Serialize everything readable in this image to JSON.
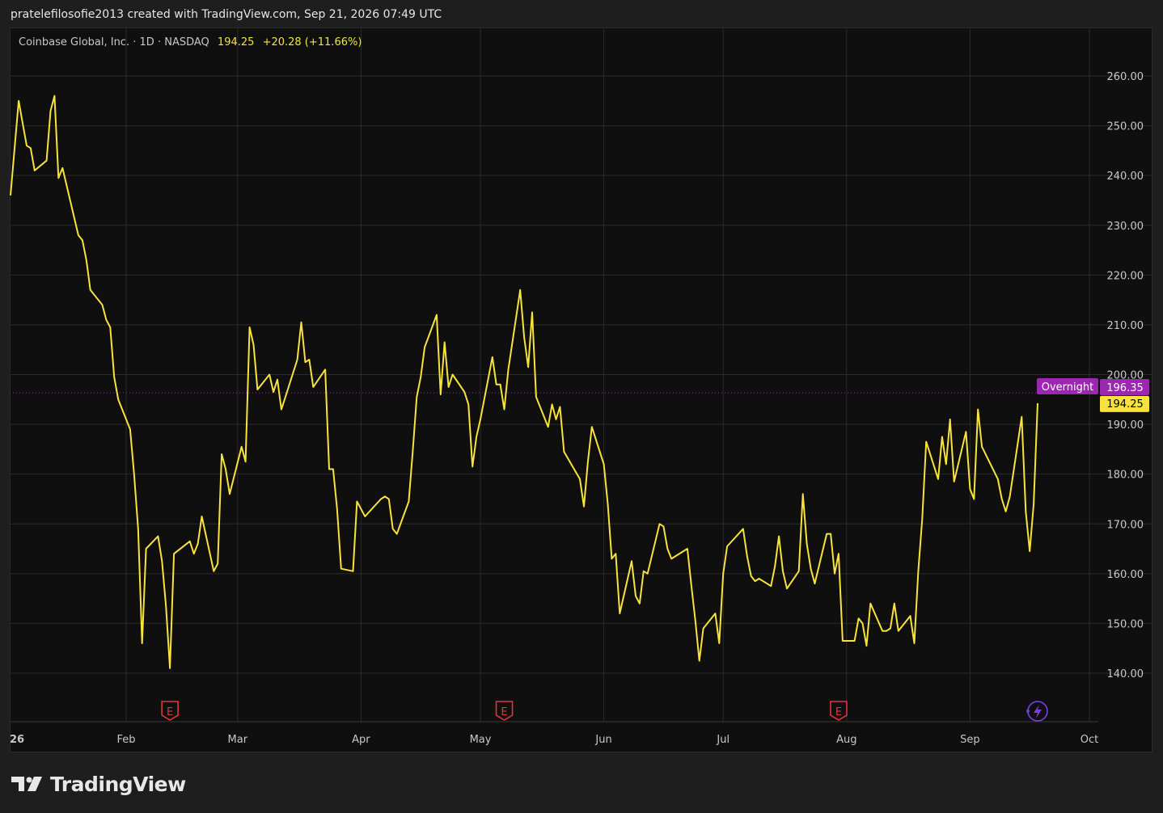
{
  "header": {
    "attribution": "pratelefilosofie2013 created with TradingView.com, Sep 21, 2026 07:49 UTC"
  },
  "symbol": {
    "name": "Coinbase Global, Inc.",
    "interval": "1D",
    "exchange": "NASDAQ",
    "price": "194.25",
    "change": "+20.28 (+11.66%)",
    "separator": "·"
  },
  "labels": {
    "overnight": "Overnight",
    "overnight_price": "196.35",
    "last_price": "194.25",
    "earnings_marker": "E"
  },
  "footer": {
    "brand": "TradingView"
  },
  "colors": {
    "line": "#f7e33b",
    "background": "#0f0f0f",
    "grid": "#2b2b2b",
    "overnight": "#9c27b0",
    "last_price_bg": "#f7e33b",
    "earnings": "#e0353f",
    "axis_text": "#c8c8c8"
  },
  "chart_data": {
    "type": "line",
    "title": "Coinbase Global, Inc. · 1D · NASDAQ",
    "ylim": [
      130,
      265
    ],
    "y_ticks": [
      "260.00",
      "250.00",
      "240.00",
      "230.00",
      "220.00",
      "210.00",
      "200.00",
      "190.00",
      "180.00",
      "170.00",
      "160.00",
      "150.00",
      "140.00"
    ],
    "x_ticks": [
      "26",
      "Feb",
      "Mar",
      "Apr",
      "May",
      "Jun",
      "Jul",
      "Aug",
      "Sep",
      "Oct"
    ],
    "grid": true,
    "overnight_price": 196.35,
    "last_price": 194.25,
    "earnings_dates": [
      "2026-02-12",
      "2026-05-07",
      "2026-07-30"
    ],
    "series": [
      {
        "x": [
          "2026-01-02",
          "2026-01-05",
          "2026-01-06",
          "2026-01-07",
          "2026-01-08",
          "2026-01-09",
          "2026-01-12",
          "2026-01-13",
          "2026-01-14",
          "2026-01-15",
          "2026-01-16",
          "2026-01-20",
          "2026-01-21",
          "2026-01-22",
          "2026-01-23",
          "2026-01-26",
          "2026-01-27",
          "2026-01-28",
          "2026-01-29",
          "2026-01-30",
          "2026-02-02",
          "2026-02-03",
          "2026-02-04",
          "2026-02-05",
          "2026-02-06",
          "2026-02-09",
          "2026-02-10",
          "2026-02-11",
          "2026-02-12",
          "2026-02-13",
          "2026-02-17",
          "2026-02-18",
          "2026-02-19",
          "2026-02-20",
          "2026-02-23",
          "2026-02-24",
          "2026-02-25",
          "2026-02-26",
          "2026-02-27",
          "2026-03-02",
          "2026-03-03",
          "2026-03-04",
          "2026-03-05",
          "2026-03-06",
          "2026-03-09",
          "2026-03-10",
          "2026-03-11",
          "2026-03-12",
          "2026-03-13",
          "2026-03-16",
          "2026-03-17",
          "2026-03-18",
          "2026-03-19",
          "2026-03-20",
          "2026-03-23",
          "2026-03-24",
          "2026-03-25",
          "2026-03-26",
          "2026-03-27",
          "2026-03-30",
          "2026-03-31",
          "2026-04-01",
          "2026-04-02",
          "2026-04-06",
          "2026-04-07",
          "2026-04-08",
          "2026-04-09",
          "2026-04-10",
          "2026-04-13",
          "2026-04-14",
          "2026-04-15",
          "2026-04-16",
          "2026-04-17",
          "2026-04-20",
          "2026-04-21",
          "2026-04-22",
          "2026-04-23",
          "2026-04-24",
          "2026-04-27",
          "2026-04-28",
          "2026-04-29",
          "2026-04-30",
          "2026-05-01",
          "2026-05-04",
          "2026-05-05",
          "2026-05-06",
          "2026-05-07",
          "2026-05-08",
          "2026-05-11",
          "2026-05-12",
          "2026-05-13",
          "2026-05-14",
          "2026-05-15",
          "2026-05-18",
          "2026-05-19",
          "2026-05-20",
          "2026-05-21",
          "2026-05-22",
          "2026-05-26",
          "2026-05-27",
          "2026-05-28",
          "2026-05-29",
          "2026-06-01",
          "2026-06-02",
          "2026-06-03",
          "2026-06-04",
          "2026-06-05",
          "2026-06-08",
          "2026-06-09",
          "2026-06-10",
          "2026-06-11",
          "2026-06-12",
          "2026-06-15",
          "2026-06-16",
          "2026-06-17",
          "2026-06-18",
          "2026-06-22",
          "2026-06-23",
          "2026-06-24",
          "2026-06-25",
          "2026-06-26",
          "2026-06-29",
          "2026-06-30",
          "2026-07-01",
          "2026-07-02",
          "2026-07-06",
          "2026-07-07",
          "2026-07-08",
          "2026-07-09",
          "2026-07-10",
          "2026-07-13",
          "2026-07-14",
          "2026-07-15",
          "2026-07-16",
          "2026-07-17",
          "2026-07-20",
          "2026-07-21",
          "2026-07-22",
          "2026-07-23",
          "2026-07-24",
          "2026-07-27",
          "2026-07-28",
          "2026-07-29",
          "2026-07-30",
          "2026-07-31",
          "2026-08-03",
          "2026-08-04",
          "2026-08-05",
          "2026-08-06",
          "2026-08-07",
          "2026-08-10",
          "2026-08-11",
          "2026-08-12",
          "2026-08-13",
          "2026-08-14",
          "2026-08-17",
          "2026-08-18",
          "2026-08-19",
          "2026-08-20",
          "2026-08-21",
          "2026-08-24",
          "2026-08-25",
          "2026-08-26",
          "2026-08-27",
          "2026-08-28",
          "2026-08-31",
          "2026-09-01",
          "2026-09-02",
          "2026-09-03",
          "2026-09-04",
          "2026-09-08",
          "2026-09-09",
          "2026-09-10",
          "2026-09-11",
          "2026-09-14",
          "2026-09-15",
          "2026-09-16",
          "2026-09-17",
          "2026-09-18"
        ],
        "values": [
          236.0,
          255.0,
          250.5,
          246.0,
          245.5,
          241.0,
          243.0,
          253.0,
          256.0,
          239.5,
          241.5,
          228.0,
          227.0,
          223.0,
          217.0,
          214.0,
          211.0,
          209.5,
          199.5,
          195.0,
          189.0,
          180.0,
          169.0,
          146.0,
          165.0,
          167.5,
          162.5,
          153.5,
          141.0,
          164.0,
          166.5,
          164.0,
          166.0,
          171.5,
          160.5,
          162.0,
          184.0,
          181.0,
          176.0,
          185.5,
          182.5,
          209.5,
          206.0,
          197.0,
          200.0,
          196.5,
          199.0,
          193.0,
          195.5,
          203.0,
          210.5,
          202.5,
          203.0,
          197.5,
          201.0,
          181.0,
          181.0,
          173.0,
          161.0,
          160.5,
          174.5,
          173.0,
          171.5,
          175.0,
          175.5,
          175.0,
          169.0,
          168.0,
          174.5,
          184.5,
          195.5,
          199.5,
          205.5,
          212.0,
          196.0,
          206.5,
          197.5,
          200.0,
          196.5,
          194.0,
          181.5,
          187.5,
          191.0,
          203.5,
          198.0,
          198.0,
          193.0,
          201.0,
          217.0,
          207.5,
          201.5,
          212.5,
          195.5,
          189.5,
          194.0,
          191.0,
          193.5,
          184.5,
          179.0,
          173.5,
          182.5,
          189.5,
          182.0,
          174.0,
          163.0,
          164.0,
          152.0,
          162.5,
          155.5,
          154.0,
          160.5,
          160.0,
          170.0,
          169.5,
          165.0,
          163.0,
          165.0,
          157.5,
          150.5,
          142.5,
          149.0,
          152.0,
          146.0,
          160.0,
          165.5,
          169.0,
          163.5,
          159.5,
          158.5,
          159.0,
          157.5,
          161.5,
          167.5,
          160.5,
          157.0,
          160.5,
          176.0,
          166.0,
          161.0,
          158.0,
          168.0,
          168.0,
          160.0,
          164.0,
          146.5,
          146.5,
          151.0,
          150.0,
          145.5,
          154.0,
          148.5,
          148.5,
          149.0,
          154.0,
          148.5,
          151.5,
          146.0,
          160.5,
          171.0,
          186.5,
          179.0,
          187.5,
          182.0,
          191.0,
          178.5,
          188.5,
          177.0,
          175.0,
          193.0,
          185.5,
          179.0,
          175.0,
          172.5,
          175.5,
          191.5,
          172.5,
          164.5,
          174.0,
          194.25
        ]
      }
    ]
  }
}
